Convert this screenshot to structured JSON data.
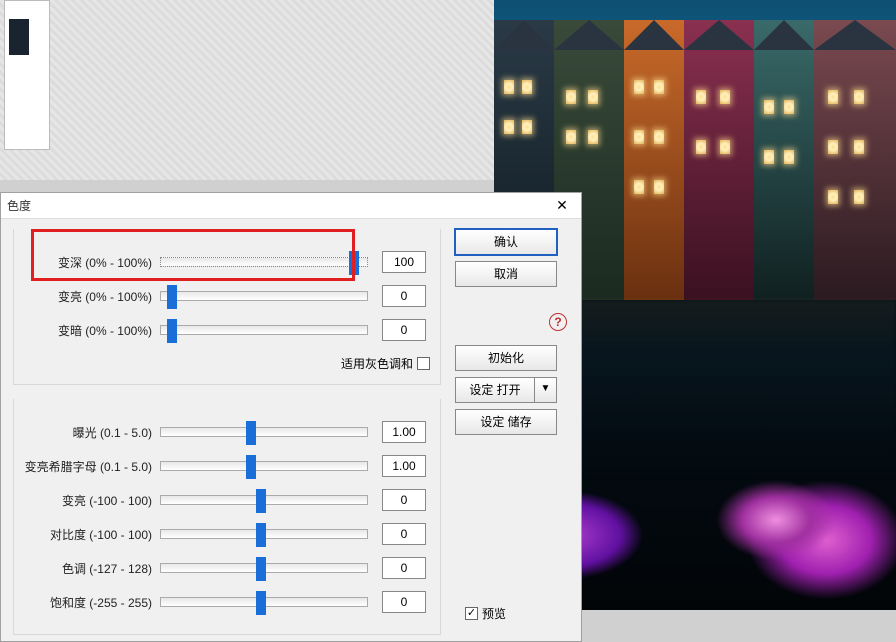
{
  "dialog": {
    "title": "色度",
    "close": "✕",
    "group1": {
      "darken": {
        "label": "变深 (0% - 100%)",
        "value": "100",
        "pct": 95
      },
      "lighten": {
        "label": "变亮 (0% - 100%)",
        "value": "0",
        "pct": 3
      },
      "dim": {
        "label": "变暗 (0% - 100%)",
        "value": "0",
        "pct": 3
      },
      "grayscale_label": "适用灰色调和",
      "grayscale_checked": false
    },
    "group2": {
      "exposure": {
        "label": "曝光 (0.1 - 5.0)",
        "value": "1.00",
        "pct": 43
      },
      "gamma": {
        "label": "变亮希腊字母 (0.1 - 5.0)",
        "value": "1.00",
        "pct": 43
      },
      "bright": {
        "label": "变亮 (-100 - 100)",
        "value": "0",
        "pct": 48
      },
      "contrast": {
        "label": "对比度 (-100 - 100)",
        "value": "0",
        "pct": 48
      },
      "hue": {
        "label": "色调 (-127 - 128)",
        "value": "0",
        "pct": 48
      },
      "sat": {
        "label": "饱和度 (-255 - 255)",
        "value": "0",
        "pct": 48
      }
    },
    "buttons": {
      "ok": "确认",
      "cancel": "取消",
      "init": "初始化",
      "set_open": "设定 打开",
      "set_save": "设定 储存"
    },
    "help": "?",
    "preview_label": "预览",
    "preview_checked": true
  }
}
